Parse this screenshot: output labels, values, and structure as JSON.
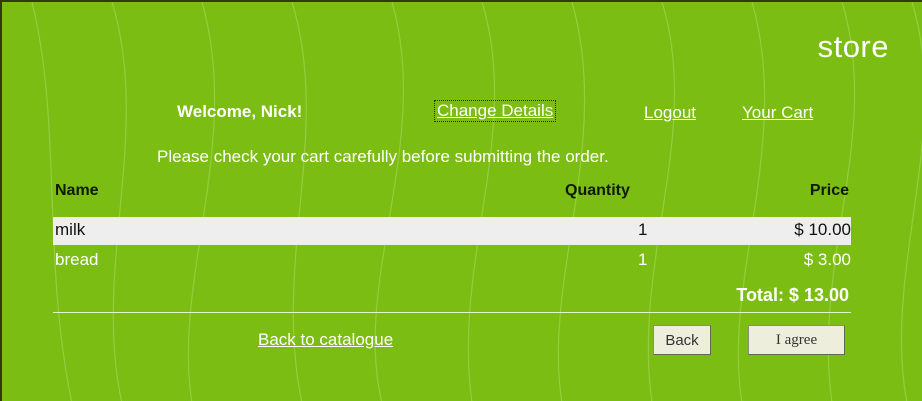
{
  "header": {
    "store_title": "store",
    "welcome": "Welcome, Nick!",
    "links": {
      "change_details": "Change Details",
      "logout": "Logout",
      "your_cart": "Your Cart"
    },
    "notice": "Please check your cart carefully before submitting the order."
  },
  "cart": {
    "columns": {
      "name": "Name",
      "quantity": "Quantity",
      "price": "Price"
    },
    "rows": [
      {
        "name": "milk",
        "quantity": "1",
        "price": "$ 10.00"
      },
      {
        "name": "bread",
        "quantity": "1",
        "price": "$ 3.00"
      }
    ],
    "total": "Total: $ 13.00"
  },
  "footer": {
    "back_link": "Back to catalogue",
    "back_button": "Back",
    "agree_button": "I agree"
  },
  "colors": {
    "background": "#7bbd13",
    "text": "#ffffff",
    "header_text": "#0f1a00",
    "highlight_row": "#eeeeee",
    "button_bg": "#eeeedd"
  }
}
